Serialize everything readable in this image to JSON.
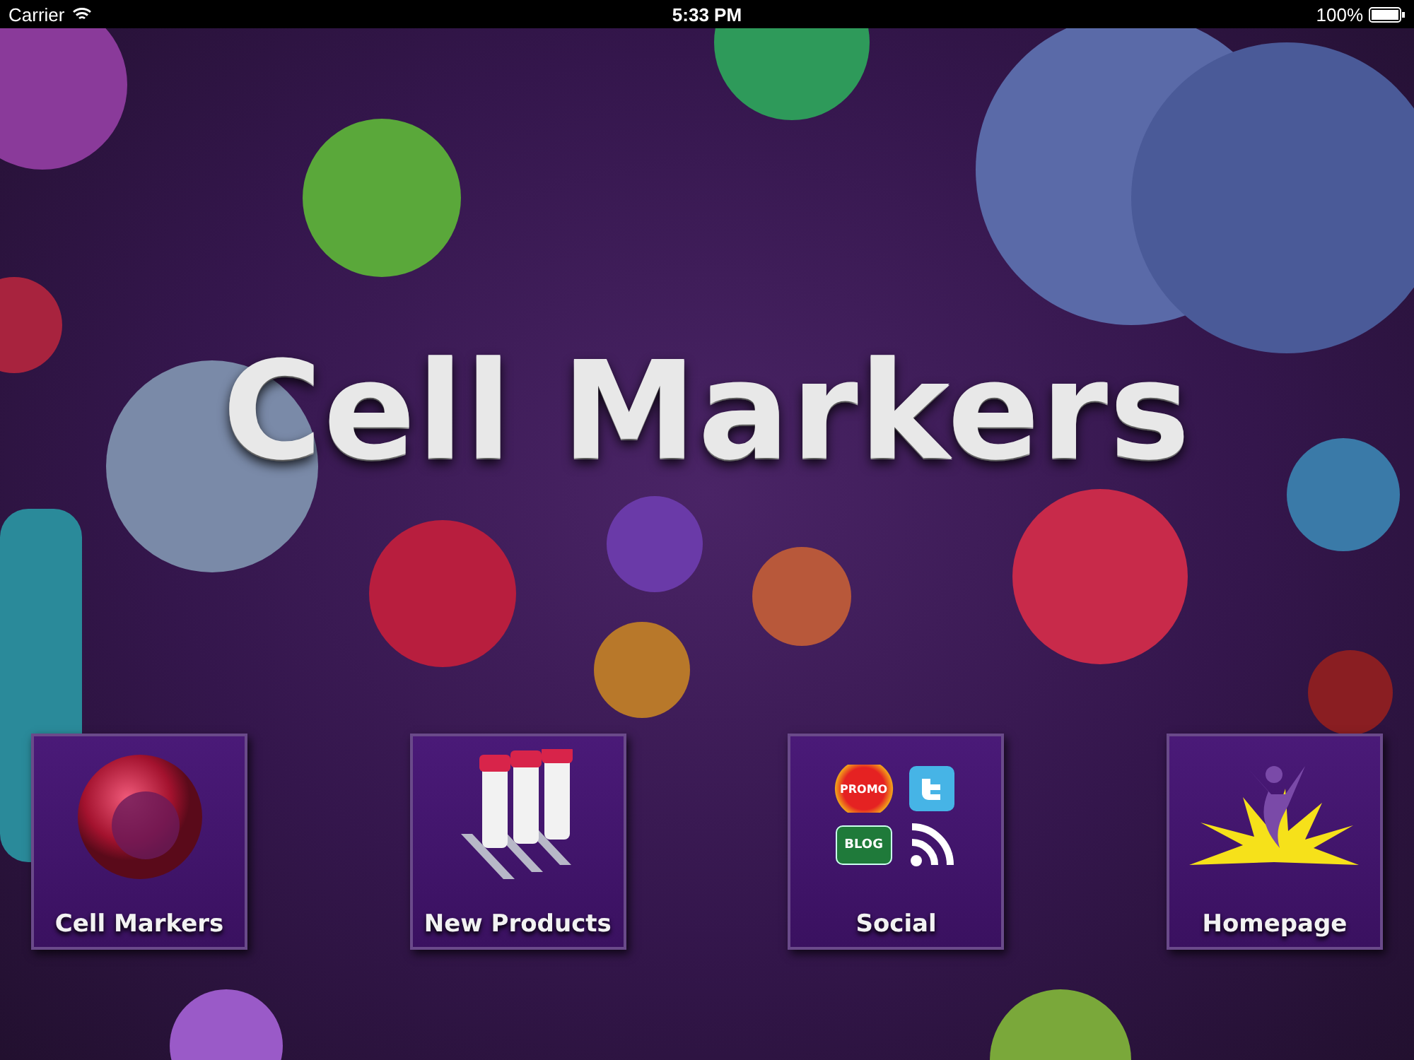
{
  "status_bar": {
    "carrier": "Carrier",
    "time": "5:33 PM",
    "battery": "100%"
  },
  "title": "Cell Markers",
  "tiles": [
    {
      "kind": "cell",
      "label": "Cell Markers"
    },
    {
      "kind": "products",
      "label": "New Products"
    },
    {
      "kind": "social",
      "label": "Social",
      "promo": "PROMO",
      "blog": "BLOG"
    },
    {
      "kind": "homepage",
      "label": "Homepage"
    }
  ]
}
